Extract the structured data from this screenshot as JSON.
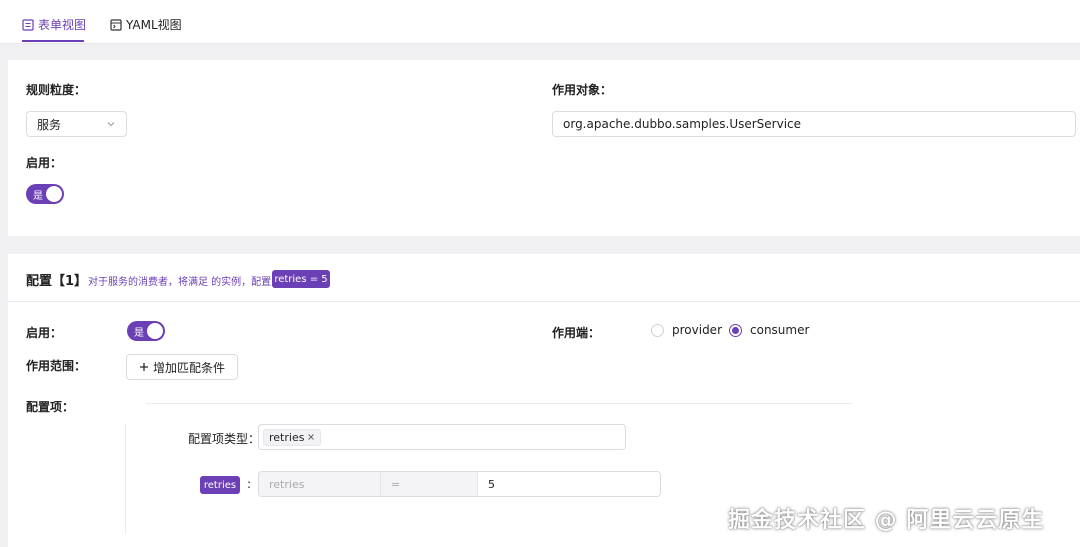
{
  "tabs": {
    "form": "表单视图",
    "yaml": "YAML视图"
  },
  "basic": {
    "granularity_label": "规则粒度：",
    "granularity_value": "服务",
    "target_label": "作用对象：",
    "target_value": "org.apache.dubbo.samples.UserService",
    "enable_label": "启用：",
    "enable_switch_text": "是"
  },
  "config": {
    "title": "配置【1】",
    "description": "对于服务的消费者，将满足 的实例，配置",
    "summary_tag": "retries = 5",
    "enable_label": "启用：",
    "enable_switch_text": "是",
    "side_label": "作用端：",
    "side_options": [
      "provider",
      "consumer"
    ],
    "side_selected": "consumer",
    "scope_label": "作用范围：",
    "add_condition_button": "增加匹配条件",
    "items_label": "配置项：",
    "item_type_label": "配置项类型：",
    "item_type_chip": "retries",
    "param_tag": "retries",
    "param_colon": ":",
    "param_key_placeholder": "retries",
    "param_op": "=",
    "param_value": "5"
  },
  "watermark": "掘金技术社区 @ 阿里云云原生",
  "colors": {
    "accent": "#6b3fb5",
    "background": "#f0f0f2"
  }
}
